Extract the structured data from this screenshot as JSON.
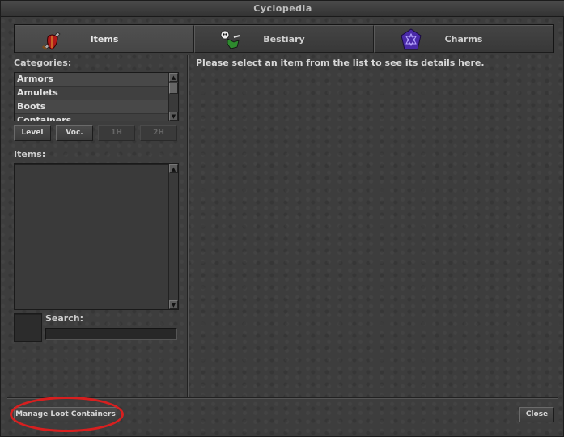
{
  "window": {
    "title": "Cyclopedia"
  },
  "tabs": [
    {
      "label": "Items",
      "icon": "sword-shield-icon",
      "active": true
    },
    {
      "label": "Bestiary",
      "icon": "skeleton-icon",
      "active": false
    },
    {
      "label": "Charms",
      "icon": "charm-crystal-icon",
      "active": false
    }
  ],
  "categories": {
    "label": "Categories:",
    "items": [
      "Armors",
      "Amulets",
      "Boots",
      "Containers"
    ]
  },
  "filters": {
    "level": "Level",
    "vocation": "Voc.",
    "one_hand": "1H",
    "two_hand": "2H"
  },
  "items_list": {
    "label": "Items:"
  },
  "search": {
    "label": "Search:",
    "value": "",
    "placeholder": ""
  },
  "details": {
    "message": "Please select an item from the list to see its details here."
  },
  "footer": {
    "manage_loot_label": "Manage Loot Containers",
    "close_label": "Close"
  },
  "colors": {
    "highlight": "#d81f1f",
    "background": "#3d3d3d"
  }
}
